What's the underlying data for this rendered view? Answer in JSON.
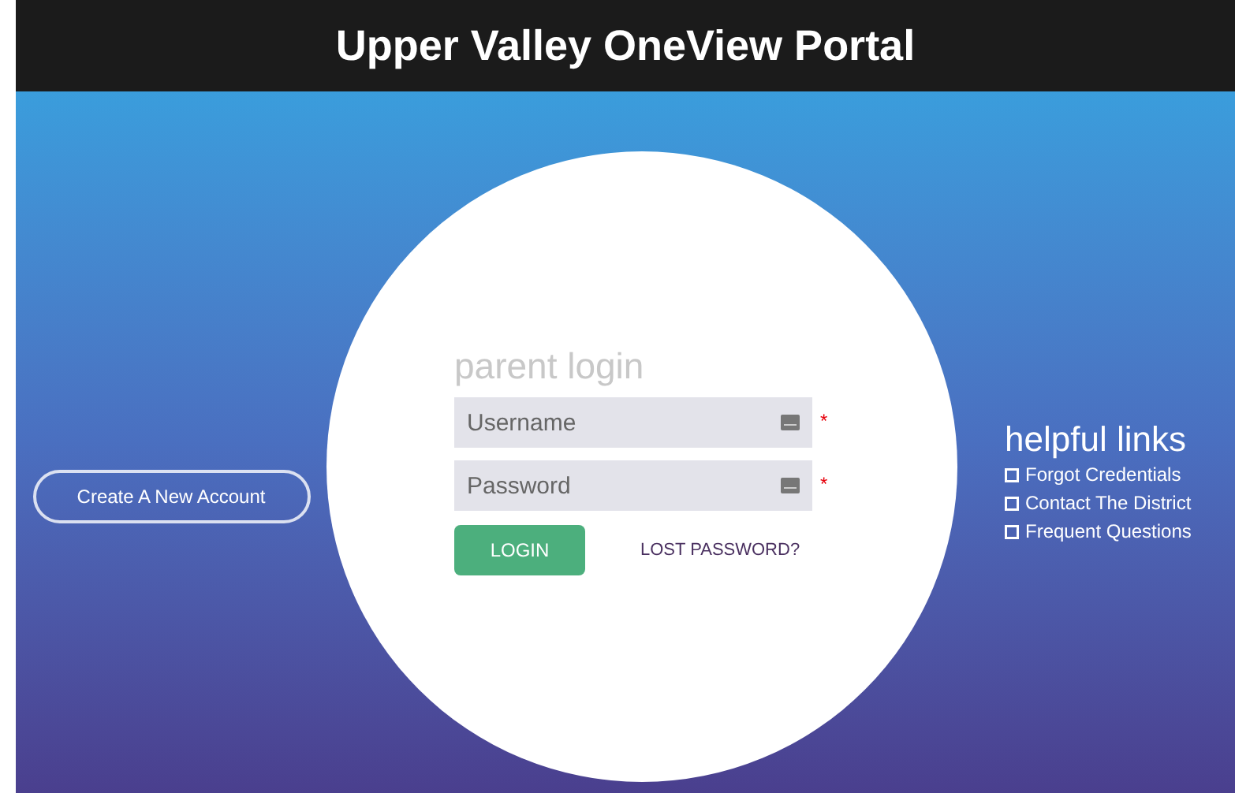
{
  "header": {
    "title": "Upper Valley OneView Portal"
  },
  "create_account": {
    "label": "Create A New Account"
  },
  "login": {
    "title": "parent login",
    "fields": [
      {
        "placeholder": "Username",
        "required_mark": "*"
      },
      {
        "placeholder": "Password",
        "required_mark": "*"
      }
    ],
    "login_button": "LOGIN",
    "lost_password": "LOST PASSWORD?"
  },
  "helpful_links": {
    "title": "helpful links",
    "items": [
      {
        "label": "Forgot Credentials"
      },
      {
        "label": "Contact The District"
      },
      {
        "label": "Frequent Questions"
      }
    ]
  }
}
